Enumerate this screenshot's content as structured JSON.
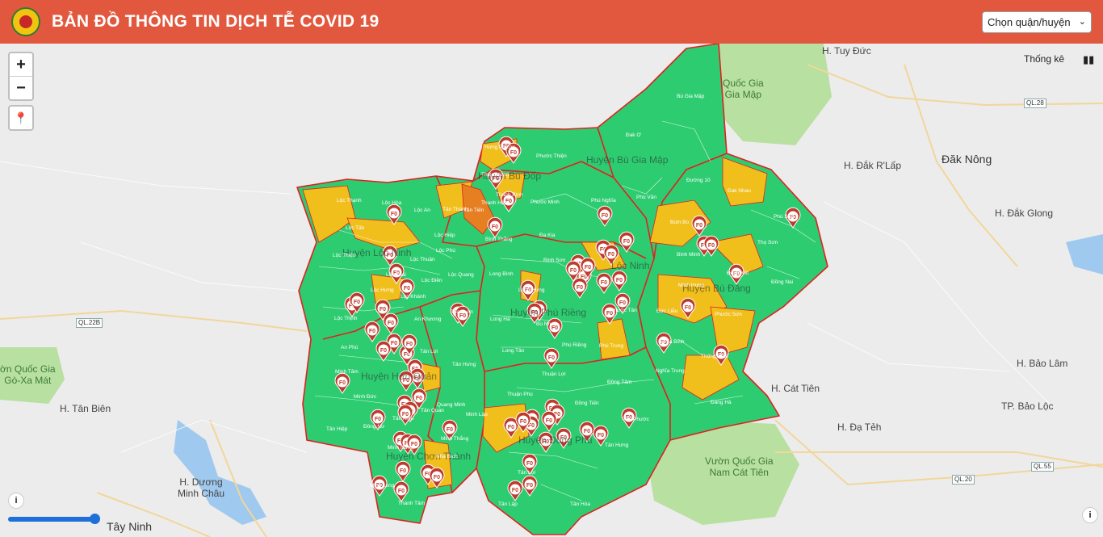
{
  "header": {
    "title": "BẢN ĐỒ THÔNG TIN DỊCH TỄ COVID 19",
    "district_select": "Chọn quận/huyện"
  },
  "controls": {
    "zoom_in": "+",
    "zoom_out": "−",
    "stats_label": "Thống kê"
  },
  "map": {
    "places": [
      {
        "id": "p1",
        "text": "H. Tuy Đức"
      },
      {
        "id": "p2",
        "text": "Quốc Gia\nGia Mập"
      },
      {
        "id": "p3",
        "text": "H. Đắk R'Lấp"
      },
      {
        "id": "p4",
        "text": "Đăk Nông"
      },
      {
        "id": "p5",
        "text": "H. Đắk Glong"
      },
      {
        "id": "p6",
        "text": "H. Tân Biên"
      },
      {
        "id": "p7",
        "text": "ờn Quốc Gia\nGò-Xa Mát"
      },
      {
        "id": "p8",
        "text": "H. Dương\nMinh Châu"
      },
      {
        "id": "p9",
        "text": "Tây Ninh"
      },
      {
        "id": "p10",
        "text": "H. Cát Tiên"
      },
      {
        "id": "p11",
        "text": "H. Đạ Tẻh"
      },
      {
        "id": "p12",
        "text": "H. Bảo Lâm"
      },
      {
        "id": "p13",
        "text": "TP. Bảo Lộc"
      },
      {
        "id": "p14",
        "text": "Vườn Quốc Gia\nNam Cát Tiên"
      }
    ],
    "roads": [
      "QL.28",
      "QL.22B",
      "QL.55",
      "QL.20"
    ],
    "districts": [
      "Huyện Bù Gia Mập",
      "Huyện Bù Đốp",
      "Huyện Lộc Ninh",
      "Huyện Phú Riềng",
      "Huyện Bù Đăng",
      "Huyện Hớn Quản",
      "Huyện Chơn Thành",
      "Huyện Đồng Phú",
      "Lộc Ninh"
    ],
    "communes": [
      "Bù Gia Mập",
      "Đak Ơ",
      "Phước Thiện",
      "Hưng Phước",
      "Thiện Hưng",
      "Thanh Bình",
      "Thanh Hòa",
      "Tân Thành",
      "Tân Tiến",
      "Phước Minh",
      "Phú Nghĩa",
      "Phú Văn",
      "Đa Kia",
      "Bình Thắng",
      "Đường 10",
      "Đak Nhau",
      "Bom Bo",
      "Phú Sơn",
      "Thọ Sơn",
      "Bình Minh",
      "Đoàn Kết",
      "Đồng Nai",
      "Minh Hưng",
      "Phước Sơn",
      "Đức Liễu",
      "Nghĩa Bình",
      "Thống Nhất",
      "Nghĩa Trung",
      "Đăng Hà",
      "Lộc Thạnh",
      "Lộc Hòa",
      "Lộc An",
      "Lộc Tấn",
      "Lộc Hiệp",
      "Lộc Thiện",
      "Lộc Thịnh",
      "Lộc Thuận",
      "Lộc Phú",
      "Lộc Thái",
      "Lộc Điền",
      "Lộc Quang",
      "Lộc Hưng",
      "Lộc Khánh",
      "Long Bình",
      "Long Hưng",
      "Bình Sơn",
      "Long Hà",
      "Bù Nho",
      "Phú Riềng",
      "Long Tân",
      "Phú Trung",
      "Phước Tân",
      "An Khương",
      "Thanh An",
      "An Phú",
      "Tân Lợi",
      "Tân Hưng",
      "Minh Tâm",
      "Minh Đức",
      "Đồng Nơ",
      "Tân Khai",
      "Tân Hiệp",
      "Tân Quan",
      "Quang Minh",
      "Minh Lập",
      "Minh Thắng",
      "Nha Bích",
      "Minh Hưng",
      "Minh Long",
      "Thành Tâm",
      "Thuận Lợi",
      "Đồng Tâm",
      "Thuận Phú",
      "Đồng Tiến",
      "Tân Phước",
      "Tân Hưng",
      "Tân Lập",
      "Tân Hòa",
      "Tân Lợi"
    ]
  },
  "marker_label": "F0"
}
